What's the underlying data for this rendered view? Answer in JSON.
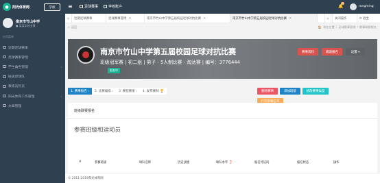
{
  "topbar": {
    "logo_text": "阳光体育网",
    "school_label": "学校",
    "nav": [
      {
        "label": "足球赛事"
      },
      {
        "label": "学校账户"
      }
    ],
    "notification_count": "9",
    "user_name": "rongming"
  },
  "sidebar": {
    "profile_name": "南京市竹山中学",
    "profile_sub": "● 某某学校全景",
    "section_label": "应用菜单",
    "items": [
      {
        "label": "近期足球赛事",
        "has_arrow": false
      },
      {
        "label": "足球赛事管理",
        "has_arrow": false
      },
      {
        "label": "学生角色管理",
        "has_arrow": true
      },
      {
        "label": "班级足球队",
        "has_arrow": false
      },
      {
        "label": "教练员列员",
        "has_arrow": false
      },
      {
        "label": "阳光体育工作管理",
        "has_arrow": true
      },
      {
        "label": "文章管理",
        "has_arrow": false
      }
    ]
  },
  "tabs": {
    "items": [
      {
        "label": "近期足球赛事"
      },
      {
        "label": "足球赛事管理"
      },
      {
        "label": "南京市竹山中学第五届校园足球对抗比赛"
      },
      {
        "label": "南京市竹山中学第五届校园足球对抗比赛"
      }
    ],
    "close_ops": "关闭操作",
    "logout": "退出"
  },
  "breadcrumb": {
    "back": "← 返回",
    "items": [
      "现在位置",
      "足球赛事管理",
      "赛事联赛报名"
    ]
  },
  "banner": {
    "title": "南京市竹山中学第五届校园足球对抗比赛",
    "meta": "班级冠军赛  |  初二组  |  男子 - 5人制比赛 - 淘汰赛  |  编号：3776444",
    "tag": "报名中",
    "buttons": [
      {
        "label": "赛事资料",
        "color": "#d9534f"
      },
      {
        "label": "邀请报名",
        "color": "#d9534f"
      },
      {
        "label": "设置 ▾",
        "color": "#5e6266"
      }
    ]
  },
  "wizard": {
    "steps": [
      {
        "label": "1. 赛事报名 ›",
        "active": true
      },
      {
        "label": "2. 比赛编排 ›",
        "active": false
      },
      {
        "label": "3. 赛程赛果 ›",
        "active": false
      },
      {
        "label": "4. 发布赛制 🏆",
        "active": false
      }
    ]
  },
  "actions": {
    "buttons": [
      {
        "label": "删除赛事",
        "color": "#ed5565"
      },
      {
        "label": "添加班级",
        "color": "#1c84c6"
      },
      {
        "label": "修改赛事类型",
        "color": "#23c6c8"
      },
      {
        "label": "打印参赛名单",
        "color": "#f8ac59"
      }
    ]
  },
  "panel": {
    "title": "班级联赛报名",
    "subtitle": "参赛班级和运动员",
    "columns": [
      "#",
      "参赛班级",
      "球队名称",
      "历史战绩",
      "球队水平 ❓",
      "报名凭证码",
      "报名状态",
      "操作"
    ]
  },
  "footer": {
    "text": "© 2011-2019阳光体育网"
  },
  "colors": {
    "sidebar_bg": "#2f4050",
    "accent": "#1ab394",
    "primary": "#1c84c6"
  }
}
